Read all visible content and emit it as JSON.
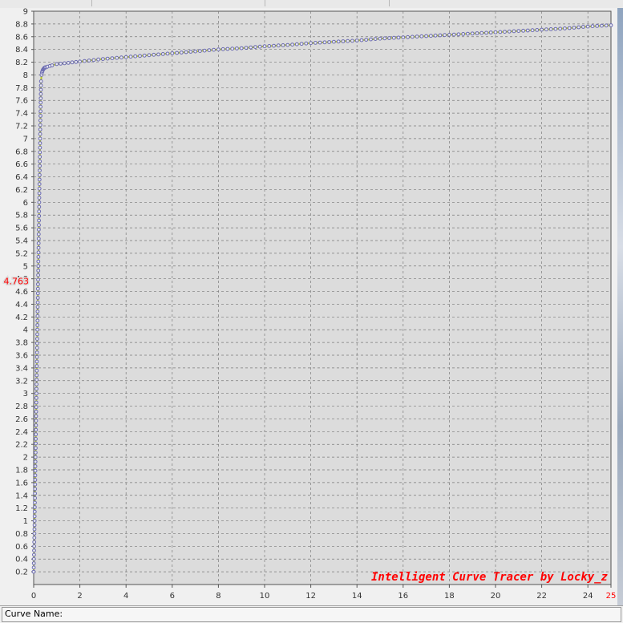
{
  "chart_data": {
    "type": "line",
    "title": "",
    "xlabel": "",
    "ylabel": "",
    "xlim": [
      0,
      25
    ],
    "ylim": [
      0,
      9
    ],
    "x_ticks": [
      "0",
      "2",
      "4",
      "6",
      "8",
      "10",
      "12",
      "14",
      "16",
      "18",
      "20",
      "22",
      "24",
      "25"
    ],
    "y_ticks": [
      "0.2",
      "0.4",
      "0.6",
      "0.8",
      "1",
      "1.2",
      "1.4",
      "1.6",
      "1.8",
      "2",
      "2.2",
      "2.4",
      "2.6",
      "2.8",
      "3",
      "3.2",
      "3.4",
      "3.6",
      "3.8",
      "4",
      "4.2",
      "4.4",
      "4.6",
      "4.8",
      "5",
      "5.2",
      "5.4",
      "5.6",
      "5.8",
      "6",
      "6.2",
      "6.4",
      "6.6",
      "6.8",
      "7",
      "7.2",
      "7.4",
      "7.6",
      "7.8",
      "8",
      "8.2",
      "8.4",
      "8.6",
      "8.8",
      "9"
    ],
    "y_marker_label": "4.763",
    "grid": true,
    "series": [
      {
        "color": "#b5c22a",
        "marker_color": "#6a6ab0",
        "x": [
          0.0,
          0.02,
          0.04,
          0.06,
          0.08,
          0.1,
          0.12,
          0.14,
          0.16,
          0.18,
          0.2,
          0.22,
          0.24,
          0.26,
          0.28,
          0.3,
          0.32,
          0.34,
          0.36,
          0.38,
          0.4,
          0.42,
          0.44,
          0.46,
          0.48,
          0.5,
          0.55,
          0.6,
          0.7,
          0.8,
          1.0,
          1.5,
          2,
          3,
          4,
          5,
          6,
          7,
          8,
          9,
          10,
          11,
          12,
          13,
          14,
          15,
          16,
          17,
          18,
          19,
          20,
          21,
          22,
          23,
          24,
          25
        ],
        "y": [
          0.2,
          0.6,
          1.0,
          1.5,
          2.0,
          2.5,
          3.0,
          3.5,
          4.0,
          4.5,
          5.0,
          5.5,
          6.0,
          6.5,
          7.0,
          7.5,
          7.9,
          8.0,
          8.04,
          8.06,
          8.08,
          8.09,
          8.1,
          8.11,
          8.11,
          8.12,
          8.12,
          8.13,
          8.14,
          8.15,
          8.17,
          8.19,
          8.21,
          8.25,
          8.28,
          8.31,
          8.34,
          8.37,
          8.4,
          8.42,
          8.45,
          8.47,
          8.5,
          8.52,
          8.54,
          8.57,
          8.59,
          8.61,
          8.63,
          8.65,
          8.67,
          8.69,
          8.71,
          8.73,
          8.76,
          8.78
        ]
      }
    ]
  },
  "watermark": "Intelligent Curve Tracer by Locky_z",
  "status": {
    "curve_name_label": "Curve Name:"
  },
  "colors": {
    "plot_bg": "#dcdcdc",
    "grid": "#7a7a7a",
    "marker_label": "#ff0000",
    "watermark": "#ff0000"
  }
}
